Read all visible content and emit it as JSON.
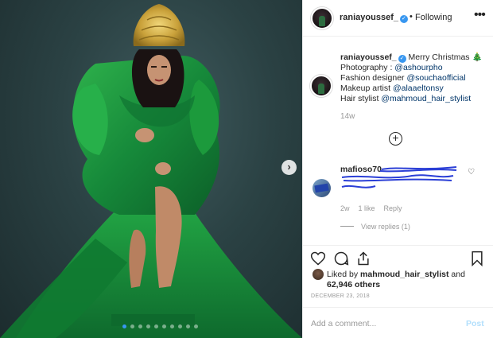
{
  "header": {
    "username": "raniayoussef_",
    "separator": "•",
    "follow_status": "Following",
    "more_icon": "ellipsis-icon",
    "verified_icon": "verified-badge-icon"
  },
  "caption": {
    "username": "raniayoussef_",
    "line1_text": "Merry Christmas 🎄",
    "line2_label": "Photography : ",
    "line2_mention": "@ashourpho",
    "line3_label": "Fashion designer ",
    "line3_mention": "@souchaofficial",
    "line4_label": "Makeup artist ",
    "line4_mention": "@alaaeltonsy",
    "line5_label": "Hair stylist ",
    "line5_mention": "@mahmoud_hair_stylist",
    "time": "14w"
  },
  "load_more_label": "+",
  "comment": {
    "username": "mafioso70",
    "time": "2w",
    "likes": "1 like",
    "reply": "Reply",
    "view_replies": "View replies (1)"
  },
  "carousel": {
    "next_label": "›",
    "slide_count": 10,
    "active_index": 0
  },
  "likes": {
    "prefix": "Liked by ",
    "user": "mahmoud_hair_stylist",
    "and": " and",
    "others": "62,946 others"
  },
  "post_date": "DECEMBER 23, 2018",
  "comment_box": {
    "placeholder": "Add a comment...",
    "post_label": "Post"
  },
  "colors": {
    "accent": "#3897f0",
    "dress_green": "#1e9a3a",
    "crown_gold": "#c9a13a"
  }
}
